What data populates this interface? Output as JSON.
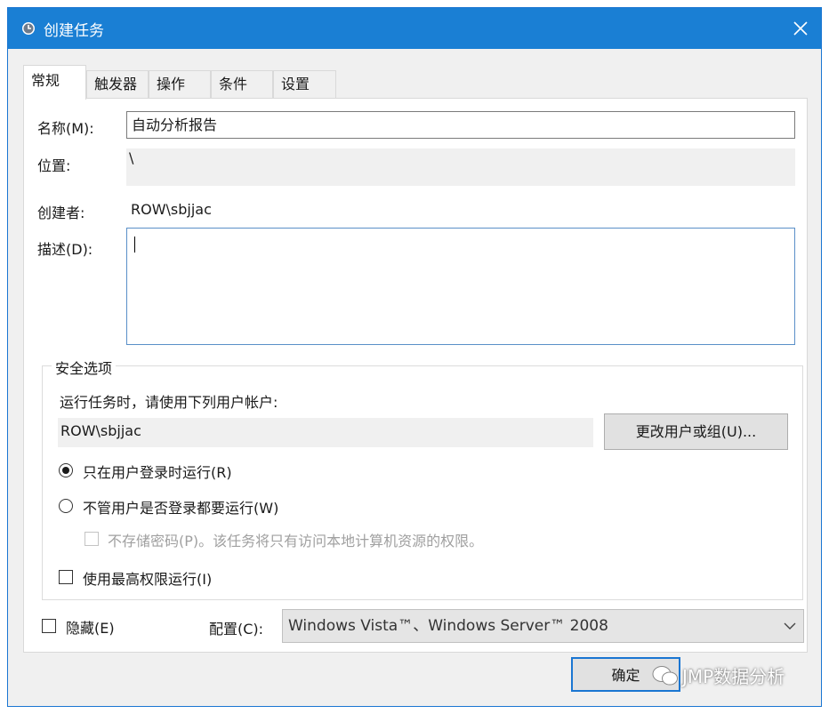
{
  "window": {
    "title": "创建任务",
    "icon": "clock-icon",
    "close_icon": "close-icon"
  },
  "tabs": [
    {
      "label": "常规",
      "active": true
    },
    {
      "label": "触发器",
      "active": false
    },
    {
      "label": "操作",
      "active": false
    },
    {
      "label": "条件",
      "active": false
    },
    {
      "label": "设置",
      "active": false
    }
  ],
  "general": {
    "name_label": "名称(M):",
    "name_value": "自动分析报告",
    "location_label": "位置:",
    "location_value": "\\",
    "author_label": "创建者:",
    "author_value": "ROW\\sbjjac",
    "description_label": "描述(D):",
    "description_value": ""
  },
  "security": {
    "group_title": "安全选项",
    "run_as_prompt": "运行任务时，请使用下列用户帐户:",
    "user_account": "ROW\\sbjjac",
    "change_user_button": "更改用户或组(U)...",
    "radio_logged_on": "只在用户登录时运行(R)",
    "radio_logged_on_checked": true,
    "radio_whether_logged": "不管用户是否登录都要运行(W)",
    "radio_whether_logged_checked": false,
    "no_store_password": "不存储密码(P)。该任务将只有访问本地计算机资源的权限。",
    "no_store_password_enabled": false,
    "highest_privileges": "使用最高权限运行(I)",
    "highest_privileges_checked": false
  },
  "bottom": {
    "hidden_label": "隐藏(E)",
    "hidden_checked": false,
    "configure_label": "配置(C):",
    "configure_value": "Windows Vista™、Windows Server™ 2008"
  },
  "buttons": {
    "ok": "确定"
  },
  "watermark": {
    "text": "JMP数据分析"
  },
  "colors": {
    "titlebar": "#1a7fd4",
    "accent_border": "#1a76d2",
    "dialog_bg": "#f0f0f0"
  }
}
